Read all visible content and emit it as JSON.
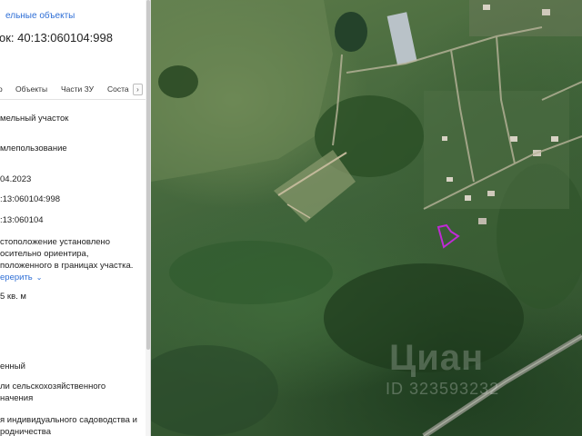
{
  "panel": {
    "back_link": "ельные объекты",
    "title": "ок: 40:13:060104:998",
    "tabs": [
      "о",
      "Объекты",
      "Части ЗУ",
      "Соста"
    ],
    "tab_next_glyph": "›",
    "rows": [
      "мельный участок",
      "млепользование",
      "04.2023",
      ":13:060104:998",
      ":13:060104",
      "стоположение установлено",
      "осительно ориентира,",
      "положенного в границах участка.",
      "ерерить",
      "5 кв. м",
      "енный",
      "ли сельскохозяйственного",
      "начения",
      "я индивидуального садоводства и",
      "родничества"
    ]
  },
  "map": {
    "watermark": "Циан",
    "watermark_id": "ID 323593232",
    "parcel_color": "#c02ad6",
    "road_color": "#b8b49a"
  }
}
